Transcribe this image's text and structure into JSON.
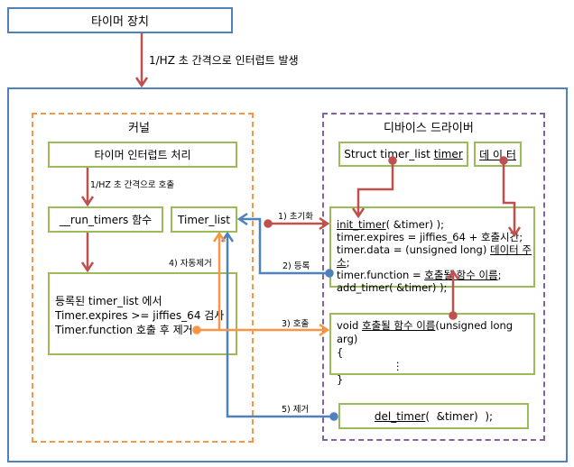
{
  "timer_device": "타이머 장치",
  "interrupt_label": "1/HZ 초 간격으로 인터럽트 발생",
  "kernel": {
    "title": "커널",
    "interrupt_handler": "타이머 인터럽트 처리",
    "call_label": "1/HZ 초 간격으로 호출",
    "run_timers": "__run_timers 함수",
    "timer_list": "Timer_list",
    "process_lines": [
      "등록된 timer_list 에서",
      "Timer.expires >= jiffies_64 검사",
      "Timer.function 호출 후 제거"
    ],
    "auto_remove": "4) 자동제거"
  },
  "driver": {
    "title": "디바이스 드라이버",
    "struct_prefix": "Struct timer_list ",
    "struct_var": "timer",
    "data_box": "데 이 터",
    "init_lines": {
      "l1a": "init_timer",
      "l1b": "( &timer) );",
      "l2": "timer.expires = jiffies_64 + 호출시간;",
      "l3a": "timer.data = (unsigned long) ",
      "l3b": "데이터 주소",
      "l3c": ";",
      "l4a": "timer.function = ",
      "l4b": "호출될 함수 이름",
      "l4c": ";",
      "l5": "add_timer( &timer) );"
    },
    "func_lines": {
      "l1a": "void ",
      "l1b": "호출될 함수 이름",
      "l1c": "(unsigned long arg)",
      "l2": "{",
      "l3": "⋮",
      "l4": "}"
    },
    "del_a": "del_timer",
    "del_b": "(  &timer)  );"
  },
  "arrows": {
    "init": "1) 초기화",
    "register": "2) 등록",
    "call": "3) 호출",
    "remove": "5) 제거"
  },
  "colors": {
    "red": "#c0504d",
    "blue": "#4f81bd",
    "orange": "#f79646",
    "purple": "#8064a2",
    "green": "#9bbb59"
  }
}
